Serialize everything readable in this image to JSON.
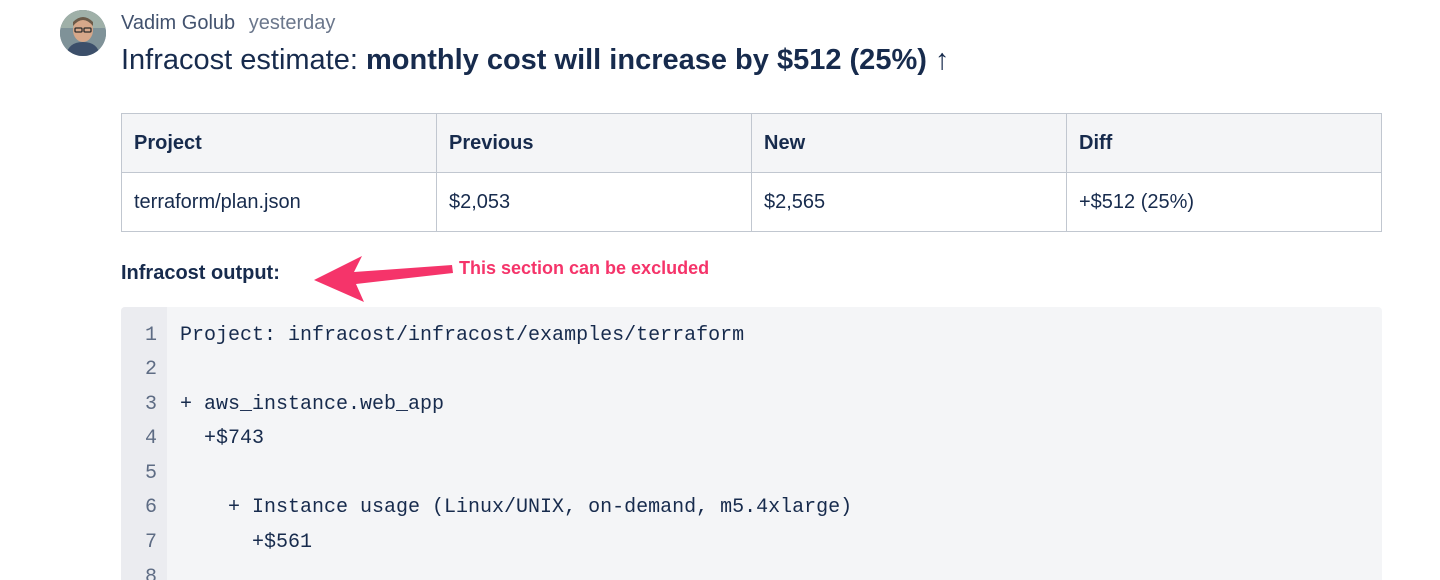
{
  "comment": {
    "author": "Vadim Golub",
    "time": "yesterday",
    "title_prefix": "Infracost estimate: ",
    "title_bold": "monthly cost will increase by $512 (25%) ↑"
  },
  "table": {
    "headers": [
      "Project",
      "Previous",
      "New",
      "Diff"
    ],
    "rows": [
      [
        "terraform/plan.json",
        "$2,053",
        "$2,565",
        "+$512 (25%)"
      ]
    ]
  },
  "output_section": {
    "label": "Infracost output:",
    "annotation": "This section can be excluded",
    "annotation_color": "#f5346a"
  },
  "code": {
    "lines": [
      {
        "n": "1",
        "text": "Project: infracost/infracost/examples/terraform"
      },
      {
        "n": "2",
        "text": ""
      },
      {
        "n": "3",
        "text": "+ aws_instance.web_app"
      },
      {
        "n": "4",
        "text": "  +$743"
      },
      {
        "n": "5",
        "text": ""
      },
      {
        "n": "6",
        "text": "    + Instance usage (Linux/UNIX, on-demand, m5.4xlarge)"
      },
      {
        "n": "7",
        "text": "      +$561"
      },
      {
        "n": "8",
        "text": ""
      }
    ]
  },
  "icons": {
    "avatar": "user-avatar-photo",
    "arrow": "arrow-left-annotation"
  }
}
